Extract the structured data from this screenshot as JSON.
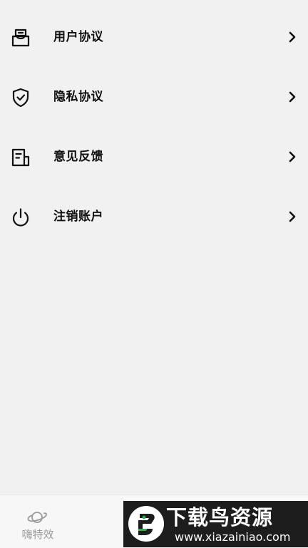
{
  "settings_menu": {
    "items": [
      {
        "label": "用户协议",
        "icon": "mailbox-icon"
      },
      {
        "label": "隐私协议",
        "icon": "shield-check-icon"
      },
      {
        "label": "意见反馈",
        "icon": "document-feedback-icon"
      },
      {
        "label": "注销账户",
        "icon": "power-icon"
      }
    ]
  },
  "bottom_nav": {
    "tabs": [
      {
        "label": "嗨特效",
        "icon": "planet-icon",
        "active": false
      }
    ]
  },
  "watermark": {
    "title": "下载鸟资源",
    "url": "www.xiazainiao.com"
  },
  "colors": {
    "background": "#f1f1f1",
    "text": "#111111",
    "tab_inactive": "#9a9a9a",
    "watermark_bg": "#1d1d1d"
  }
}
